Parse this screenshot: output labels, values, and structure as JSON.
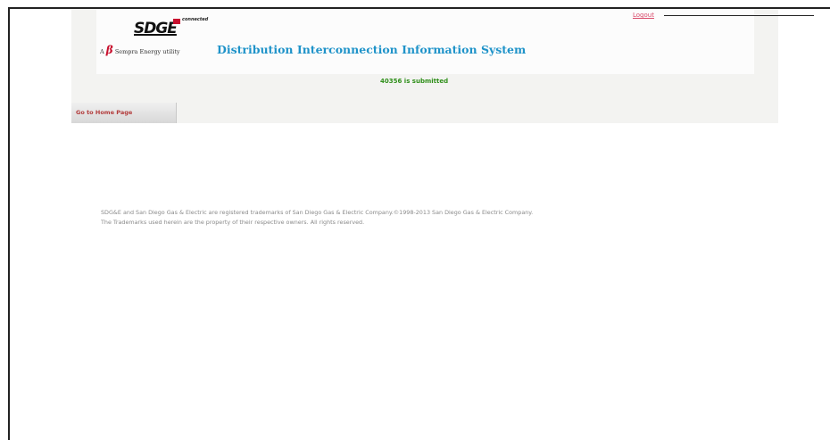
{
  "header": {
    "logo": {
      "brand": "SDGE",
      "tagline": "connected",
      "parent_prefix": "A",
      "parent_mark": "β",
      "parent_name": "Sempra Energy utility"
    },
    "system_title": "Distribution Interconnection Information System",
    "logout_label": "Logout"
  },
  "status": {
    "message": "40356 is submitted"
  },
  "nav": {
    "home_label": "Go to Home Page"
  },
  "footer": {
    "line1": "SDG&E and San Diego Gas & Electric are registered trademarks of San Diego Gas & Electric Company.©1998-2013 San Diego Gas & Electric Company.",
    "line2": "The Trademarks used herein are the property of their respective owners. All rights reserved."
  },
  "colors": {
    "title_blue": "#1f93c9",
    "status_green": "#2f8f1a",
    "logout_pink": "#d94a6a",
    "brand_red": "#c8102e"
  }
}
